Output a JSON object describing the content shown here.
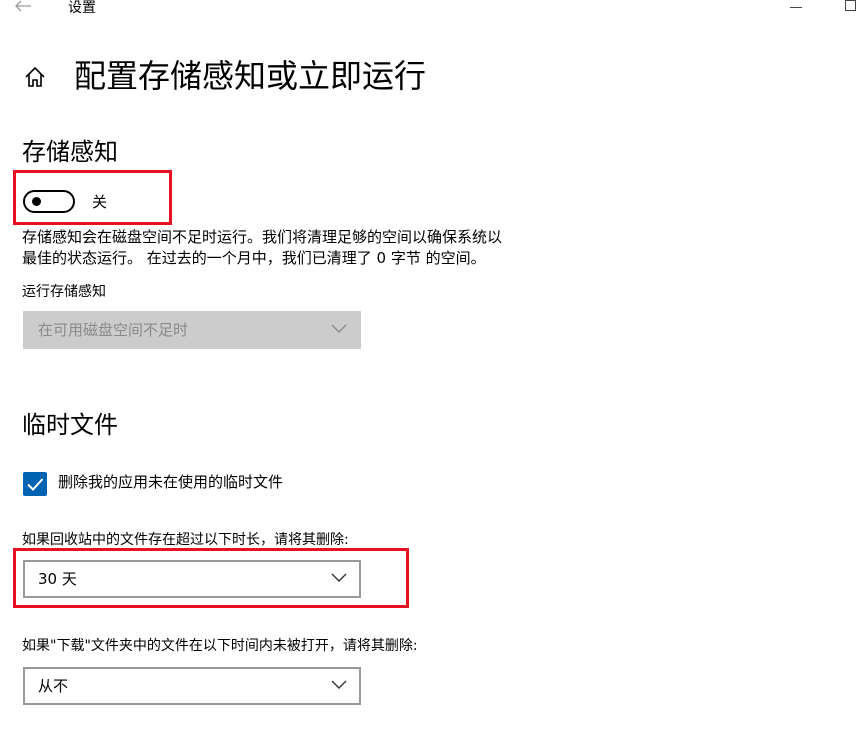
{
  "window": {
    "title": "设置"
  },
  "page": {
    "title": "配置存储感知或立即运行"
  },
  "storage_sense": {
    "heading": "存储感知",
    "toggle_state": "关",
    "description_line1": "存储感知会在磁盘空间不足时运行。我们将清理足够的空间以确保系统以",
    "description_line2": "最佳的状态运行。 在过去的一个月中，我们已清理了 0 字节 的空间。",
    "run_label": "运行存储感知",
    "run_value": "在可用磁盘空间不足时"
  },
  "temp_files": {
    "heading": "临时文件",
    "checkbox_label": "删除我的应用未在使用的临时文件",
    "checkbox_checked": true,
    "recycle_label": "如果回收站中的文件存在超过以下时长，请将其删除:",
    "recycle_value": "30 天",
    "downloads_label": "如果\"下载\"文件夹中的文件在以下时间内未被打开，请将其删除:",
    "downloads_value": "从不"
  },
  "colors": {
    "accent": "#0063b1",
    "annotation": "#e81123",
    "disabled_fill": "#cccccc"
  },
  "icons": {
    "back": "back-arrow-icon",
    "home": "home-icon",
    "chevron": "chevron-down-icon",
    "check": "checkmark-icon"
  }
}
